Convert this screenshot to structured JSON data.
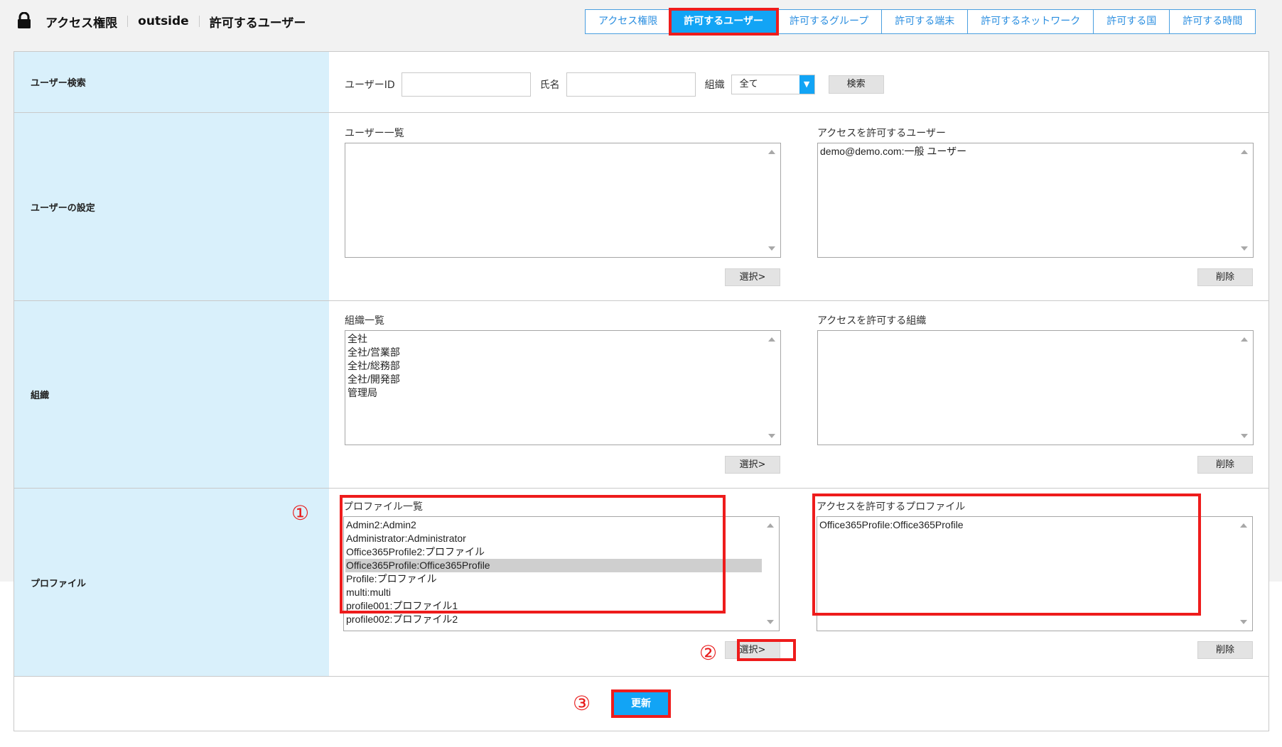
{
  "header": {
    "breadcrumbs": [
      "アクセス権限",
      "outside",
      "許可するユーザー"
    ],
    "tabs": [
      {
        "label": "アクセス権限",
        "active": false
      },
      {
        "label": "許可するユーザー",
        "active": true
      },
      {
        "label": "許可するグループ",
        "active": false
      },
      {
        "label": "許可する端末",
        "active": false
      },
      {
        "label": "許可するネットワーク",
        "active": false
      },
      {
        "label": "許可する国",
        "active": false
      },
      {
        "label": "許可する時間",
        "active": false
      }
    ]
  },
  "search": {
    "section_label": "ユーザー検索",
    "user_id_label": "ユーザーID",
    "user_id_value": "",
    "name_label": "氏名",
    "name_value": "",
    "org_label": "組織",
    "org_selected": "全て",
    "search_button": "検索"
  },
  "users": {
    "section_label": "ユーザーの設定",
    "list_title": "ユーザー一覧",
    "list_items": [],
    "select_button": "選択>",
    "allowed_title": "アクセスを許可するユーザー",
    "allowed_items": [
      "demo@demo.com:一般 ユーザー"
    ],
    "delete_button": "削除"
  },
  "org": {
    "section_label": "組織",
    "list_title": "組織一覧",
    "list_items": [
      "全社",
      "全社/営業部",
      "全社/総務部",
      "全社/開発部",
      "管理局"
    ],
    "select_button": "選択>",
    "allowed_title": "アクセスを許可する組織",
    "allowed_items": [],
    "delete_button": "削除"
  },
  "profile": {
    "section_label": "プロファイル",
    "list_title": "プロファイル一覧",
    "list_items": [
      "Admin2:Admin2",
      "Administrator:Administrator",
      "Office365Profile2:プロファイル",
      "Office365Profile:Office365Profile",
      "Profile:プロファイル",
      "multi:multi",
      "profile001:プロファイル1",
      "profile002:プロファイル2"
    ],
    "selected_item": "Office365Profile:Office365Profile",
    "select_button": "選択>",
    "allowed_title": "アクセスを許可するプロファイル",
    "allowed_items": [
      "Office365Profile:Office365Profile"
    ],
    "delete_button": "削除"
  },
  "footer": {
    "update_button": "更新"
  },
  "annotations": {
    "marker_1": "①",
    "marker_2": "②",
    "marker_3": "③"
  },
  "colors": {
    "accent": "#12a4f5",
    "annotation_red": "#ee1c1c",
    "label_bg": "#d9f0fb"
  }
}
